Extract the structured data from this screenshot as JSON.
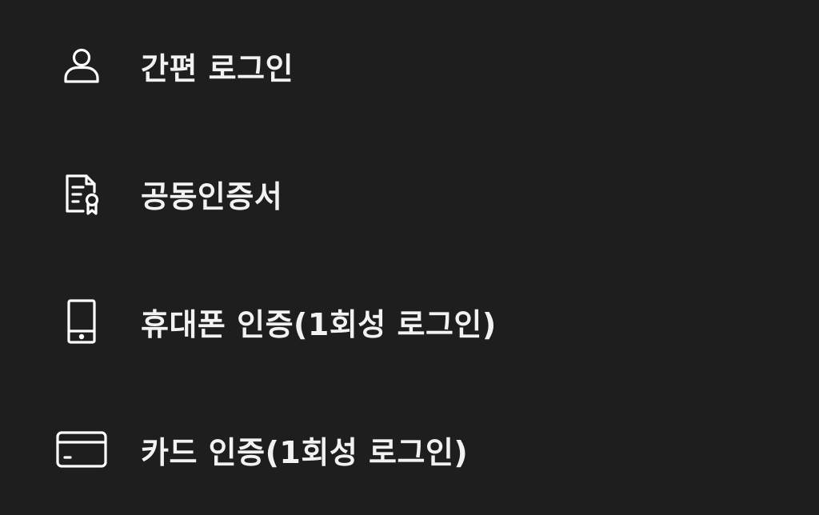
{
  "menu": {
    "items": [
      {
        "label": "간편 로그인",
        "icon": "person-icon"
      },
      {
        "label": "공동인증서",
        "icon": "certificate-icon"
      },
      {
        "label": "휴대폰 인증(1회성 로그인)",
        "icon": "mobile-phone-icon"
      },
      {
        "label": "카드 인증(1회성 로그인)",
        "icon": "credit-card-icon"
      }
    ]
  },
  "colors": {
    "background": "#1e1e1e",
    "text": "#f2f2f2",
    "icon": "#ffffff"
  }
}
